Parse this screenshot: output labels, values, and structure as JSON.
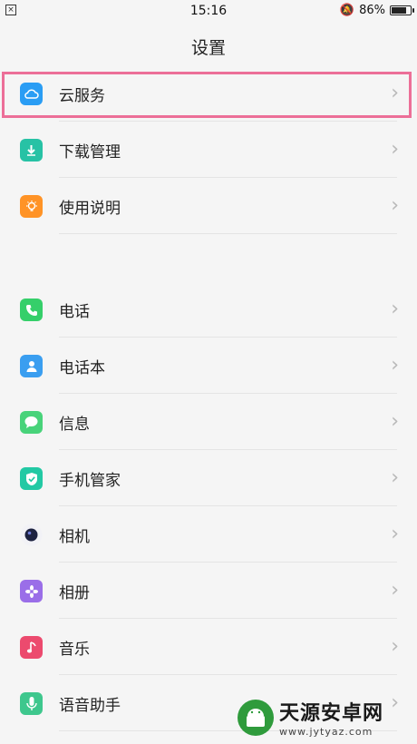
{
  "status_bar": {
    "time": "15:16",
    "battery": "86%",
    "battery_level": 0.86
  },
  "header": {
    "title": "设置"
  },
  "group1": [
    {
      "label": "云服务",
      "icon": "cloud-icon",
      "color": "#2a9df4"
    },
    {
      "label": "下载管理",
      "icon": "download-icon",
      "color": "#27c2a5"
    },
    {
      "label": "使用说明",
      "icon": "bulb-icon",
      "color": "#ff9326"
    }
  ],
  "group2": [
    {
      "label": "电话",
      "icon": "phone-icon",
      "color": "#35cf6a"
    },
    {
      "label": "电话本",
      "icon": "contacts-icon",
      "color": "#3a9ef0"
    },
    {
      "label": "信息",
      "icon": "message-icon",
      "color": "#48d37a"
    },
    {
      "label": "手机管家",
      "icon": "shield-icon",
      "color": "#22c9a4"
    },
    {
      "label": "相机",
      "icon": "camera-icon",
      "color": "#23284a"
    },
    {
      "label": "相册",
      "icon": "gallery-icon",
      "color": "#9a6ee8"
    },
    {
      "label": "音乐",
      "icon": "music-icon",
      "color": "#ec4a6e"
    },
    {
      "label": "语音助手",
      "icon": "microphone-icon",
      "color": "#3ec78d"
    }
  ],
  "chevron": "›",
  "watermark": {
    "title": "天源安卓网",
    "url": "www.jytyaz.com"
  },
  "colors": {
    "highlight": "#ec6f98",
    "background": "#f5f5f5"
  }
}
